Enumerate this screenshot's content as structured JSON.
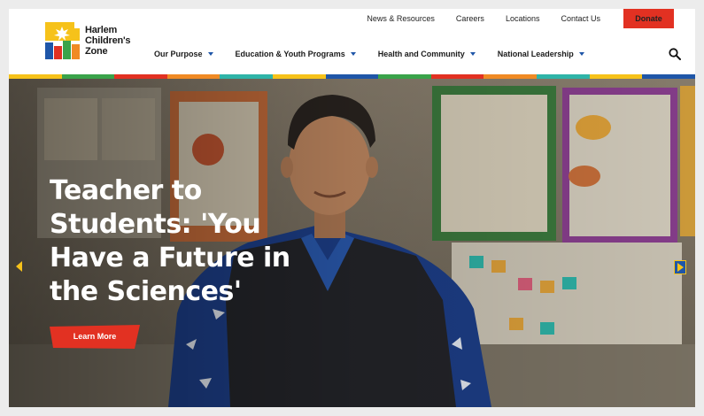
{
  "brand": {
    "name_line1": "Harlem",
    "name_line2": "Children's",
    "name_line3": "Zone"
  },
  "utility_nav": {
    "items": [
      "News & Resources",
      "Careers",
      "Locations",
      "Contact Us"
    ],
    "donate_label": "Donate"
  },
  "main_nav": {
    "items": [
      "Our Purpose",
      "Education & Youth Programs",
      "Health and Community",
      "National Leadership"
    ]
  },
  "hero": {
    "headline": "Teacher to Students: 'You Have a Future in the Sciences'",
    "cta_label": "Learn More"
  },
  "colors": {
    "accent_red": "#e23122",
    "yellow": "#f6c21a",
    "blue": "#1f56a8",
    "green": "#3aa34a",
    "orange": "#f08a24",
    "teal": "#2fb4a8"
  },
  "icons": {
    "search": "search-icon",
    "prev": "chevron-left-icon",
    "next": "chevron-right-icon"
  }
}
